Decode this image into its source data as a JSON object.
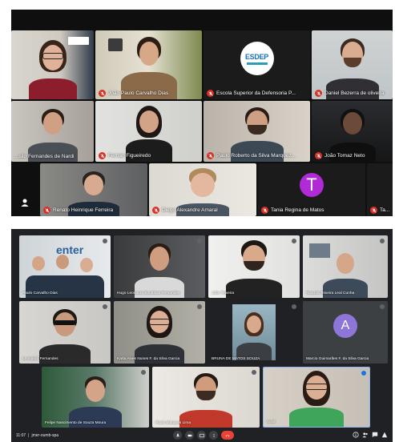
{
  "call_top": {
    "participants": [
      {
        "name": ""
      },
      {
        "name": "João Paulo Carvalho Dias"
      },
      {
        "name": "Escola Superior da Defensoria P..."
      },
      {
        "name": "Daniel Bezerra de oliveira"
      },
      {
        "name": "...silo Fernandes de Nardi"
      },
      {
        "name": "Fernan Figueiredo"
      },
      {
        "name": "Paulo Roberto da Silva Marquez..."
      },
      {
        "name": "João Tomaz Neto"
      },
      {
        "name": "Renato Heinrique Ferreira"
      },
      {
        "name": "Diego Alexandre Amaral"
      },
      {
        "name": "Tania Regina de Matos"
      },
      {
        "name": "Ta..."
      }
    ],
    "logo_text": "ESDEP",
    "avatar_letter": "T",
    "colors": {
      "mic_off": "#d93025",
      "avatar_bg": "#b02ad6"
    }
  },
  "call_bottom": {
    "participants": [
      {
        "name": "Paulo Carvalho Dias"
      },
      {
        "name": "Hugo Leonardo Bonifácio Fernandes"
      },
      {
        "name": "João Teixeira"
      },
      {
        "name": "Ricardo Teixeira Leal Cunha"
      },
      {
        "name": "Leonardo Fernandes"
      },
      {
        "name": "Karla Alves Nunes F. da Silva Garcia"
      },
      {
        "name": "BRUNA DE MATOS SOUZA"
      },
      {
        "name": "Marcio Guimarães F. da Silva Garcia"
      },
      {
        "name": "Felipe Nascimento de Souza Moura"
      },
      {
        "name": "Paulo Marques Lima"
      },
      {
        "name": "Você"
      }
    ],
    "avatar_letter": "A",
    "time": "11:07",
    "meeting_code": "jmer-oumb-spa",
    "colors": {
      "avatar_bg": "#8e75d8",
      "hangup": "#ea4335",
      "active_border": "#8ab4f8"
    }
  }
}
